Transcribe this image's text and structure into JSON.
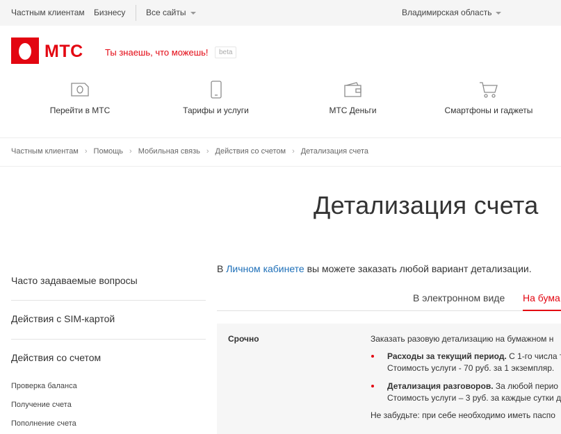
{
  "topbar": {
    "private": "Частным клиентам",
    "business": "Бизнесу",
    "all_sites": "Все сайты",
    "region": "Владимирская область"
  },
  "header": {
    "logo_text": "МТС",
    "slogan": "Ты знаешь, что можешь!",
    "beta": "beta",
    "brand_color": "#e30611"
  },
  "nav": [
    {
      "label": "Перейти в МТС",
      "icon": "sim-card-icon"
    },
    {
      "label": "Тарифы и услуги",
      "icon": "phone-icon"
    },
    {
      "label": "МТС Деньги",
      "icon": "wallet-icon"
    },
    {
      "label": "Смартфоны и гаджеты",
      "icon": "cart-icon"
    }
  ],
  "breadcrumb": [
    "Частным клиентам",
    "Помощь",
    "Мобильная связь",
    "Действия со счетом",
    "Детализация счета"
  ],
  "page_title": "Детализация счета",
  "sidebar": {
    "faq": "Часто задаваемые вопросы",
    "sim": "Действия с SIM-картой",
    "account": "Действия со счетом",
    "sub_items": [
      "Проверка баланса",
      "Получение счета",
      "Пополнение счета"
    ]
  },
  "content": {
    "intro_prefix": "В ",
    "intro_link": "Личном кабинете",
    "intro_suffix": " вы можете заказать любой вариант детализации.",
    "tab_electronic": "В электронном виде",
    "tab_paper": "На бума",
    "panel_label": "Срочно",
    "order_text": "Заказать разовую детализацию на бумажном н",
    "bullet1_bold": "Расходы за текущий период.",
    "bullet1_rest": " С 1-го числа т",
    "bullet1_price": "Стоимость услуги - 70 руб. за 1 экземпляр.",
    "bullet2_bold": "Детализация разговоров.",
    "bullet2_rest": " За любой перио",
    "bullet2_price": "Стоимость услуги – 3 руб. за каждые сутки д",
    "note": "Не забудьте: при себе необходимо иметь паспо"
  }
}
